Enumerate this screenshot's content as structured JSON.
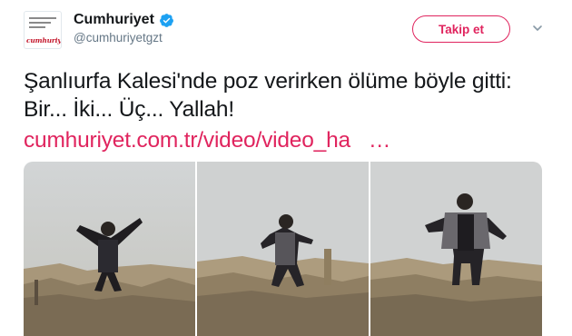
{
  "account": {
    "display_name": "Cumhuriyet",
    "handle": "@cumhuriyetgzt",
    "verified": true,
    "avatar_logo_text": "cumhuriyet"
  },
  "actions": {
    "follow_label": "Takip et",
    "more_icon": "chevron-down-icon"
  },
  "tweet": {
    "text": "Şanlıurfa Kalesi'nde poz verirken ölüme böyle gitti: Bir... İki... Üç... Yallah!",
    "link_text": "cumhuriyet.com.tr/video/video_ha",
    "link_ellipsis": "…"
  },
  "media": {
    "frame_count": 3,
    "description_icons": [
      "video-frame-1",
      "video-frame-2",
      "video-frame-3"
    ]
  },
  "colors": {
    "accent": "#e0245e",
    "verified": "#1da1f2",
    "secondary_text": "#657786",
    "primary_text": "#14171a"
  }
}
